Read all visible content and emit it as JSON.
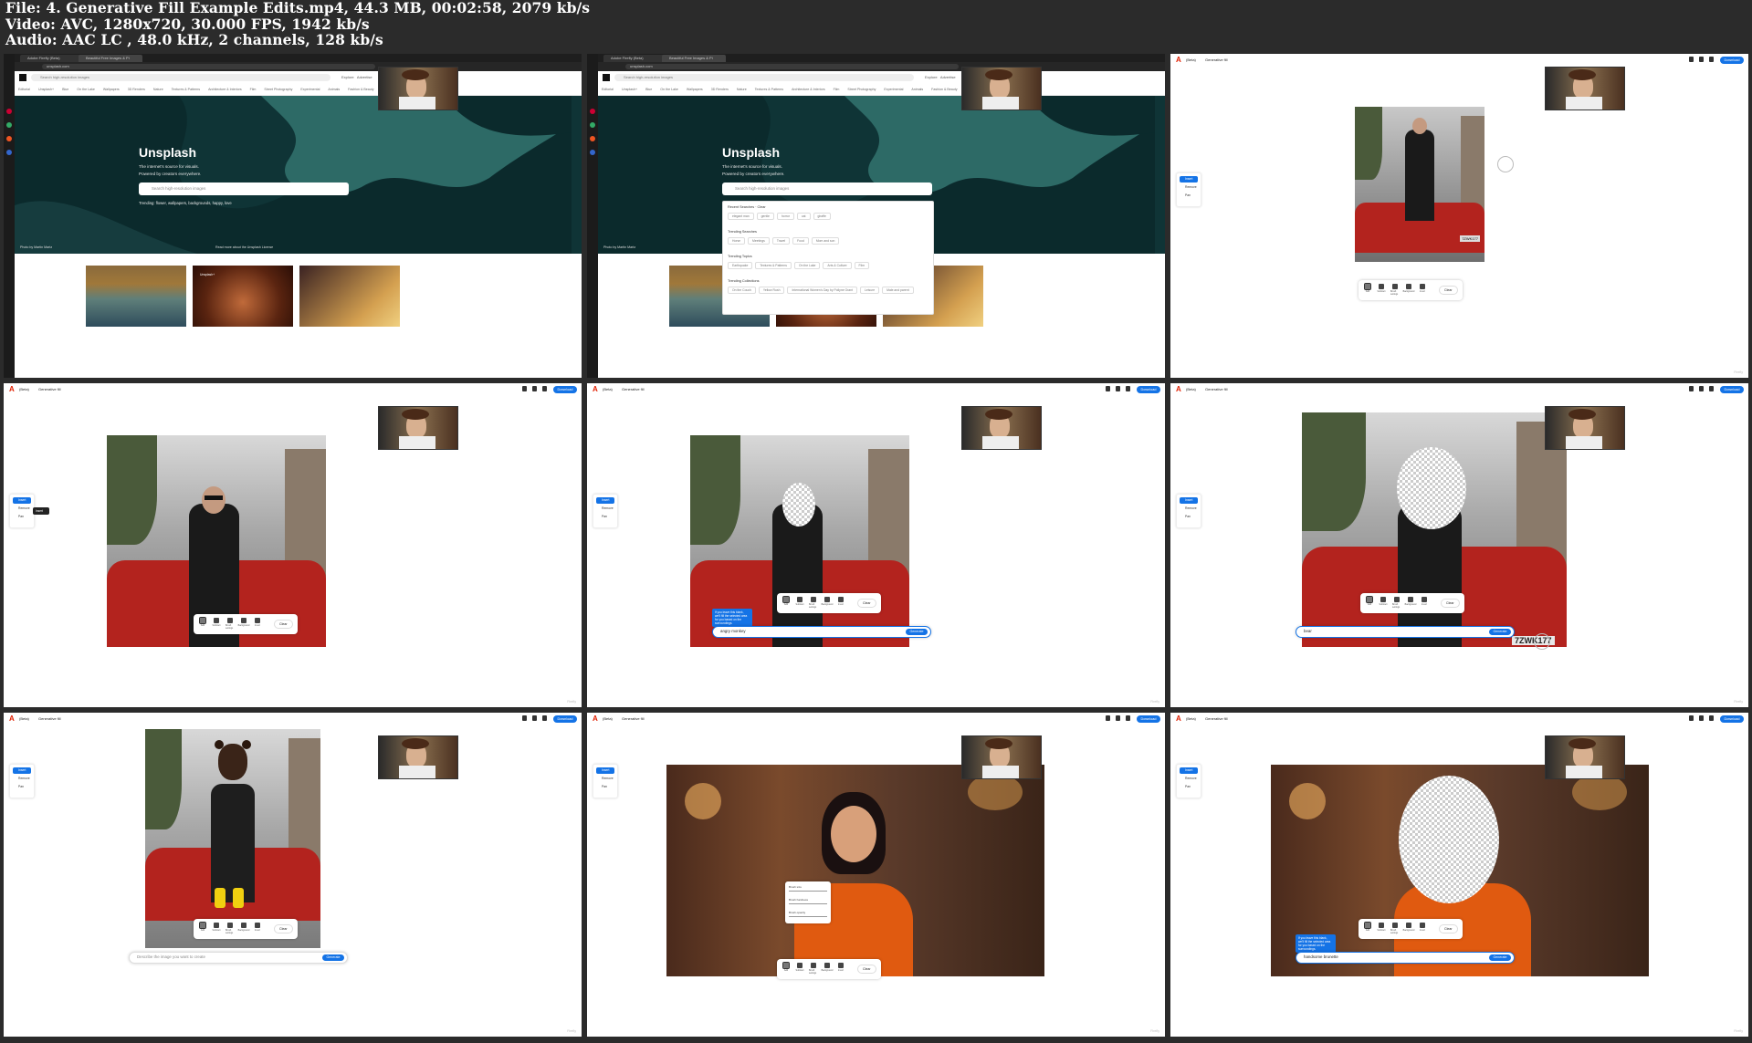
{
  "header": {
    "line1": "File: 4. Generative Fill Example Edits.mp4, 44.3 MB, 00:02:58, 2079 kb/s",
    "line2": "Video: AVC, 1280x720, 30.000 FPS, 1942 kb/s",
    "line3": "Audio: AAC LC , 48.0 kHz, 2 channels, 128 kb/s"
  },
  "colors": {
    "firefly_red": "#e01e00",
    "accent_blue": "#1473e6",
    "hero_teal": "#0f3436",
    "car_red": "#b3231e"
  },
  "unsplash": {
    "tab1": "Adobe Firefly (Beta)",
    "tab2": "Beautiful Free Images & Pi",
    "url": "unsplash.com",
    "search_placeholder": "Search high-resolution images",
    "nav_explore": "Explore",
    "nav_advertise": "Advertise",
    "categories": [
      "Editorial",
      "Unsplash+",
      "Blue",
      "On the Lake",
      "Wallpapers",
      "3D Renders",
      "Nature",
      "Textures & Patterns",
      "Architecture & Interiors",
      "Film",
      "Street Photography",
      "Experimental",
      "Animals",
      "Fashion & Beauty"
    ],
    "hero_title": "Unsplash",
    "hero_sub1": "The internet's source for visuals.",
    "hero_sub2": "Powered by creators everywhere.",
    "hero_trending": "Trending: flower, wallpapers, backgrounds, happy, love",
    "credit": "Photo by Martin Martz",
    "credit2": "Read more about the Unsplash License",
    "thumb_label": "Unsplash+",
    "dropdown": {
      "recent": "Recent Searches",
      "clear": "Clear",
      "recent_items": [
        "elegant man",
        "gentle",
        "horror",
        "cat",
        "giraffe"
      ],
      "trending_searches": "Trending Searches",
      "trending_items": [
        "Horse",
        "Meetings",
        "Travel",
        "Food",
        "Mom and son"
      ],
      "trending_topics": "Trending Topics",
      "topic_items": [
        "Earthquake",
        "Textures & Patterns",
        "On the Lake",
        "Arts & Culture",
        "Film"
      ],
      "trending_collections": "Trending Collections",
      "collection_items": [
        "On the Couch",
        "Yellow Rush",
        "International Women's Day by Pollyne Grant",
        "Leisure",
        "Male and parent"
      ]
    }
  },
  "firefly": {
    "beta": "(Beta)",
    "title": "Generative fill",
    "download": "Download",
    "tool_insert": "Insert",
    "tool_remove": "Remove",
    "tool_pan": "Pan",
    "insert_tip": "Insert",
    "toolbar": [
      "Add",
      "Subtract",
      "Brush settings",
      "Background",
      "Invert"
    ],
    "clear": "Clear",
    "generate": "Generate",
    "prompt_monkey": "angry monkey",
    "prompt_bear": "bear",
    "prompt_brunette": "handsome brunette",
    "prompt_placeholder": "Describe the image you want to create",
    "tooltip": "If you leave this blank, we'll fill the selected area for you based on the surroundings.",
    "plate": "7ZWK177",
    "brush_size": "Brush size",
    "brush_hardness": "Brush hardness",
    "brush_opacity": "Brush opacity",
    "watermark": "Firefly"
  }
}
